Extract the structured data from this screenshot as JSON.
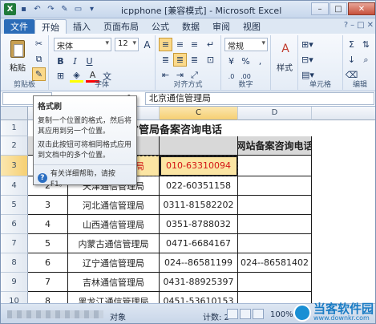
{
  "titlebar": {
    "app_icon": "X",
    "qat_icons": [
      "save-icon",
      "undo-icon",
      "redo-icon",
      "format-painter-icon",
      "open-folder-icon",
      "customize-icon"
    ],
    "title": "icpphone [兼容模式] - Microsoft Excel",
    "controls": {
      "minimize": "–",
      "maximize": "□",
      "close": "✕"
    }
  },
  "tabs": {
    "file": "文件",
    "items": [
      "开始",
      "插入",
      "页面布局",
      "公式",
      "数据",
      "审阅",
      "视图"
    ],
    "active": "开始"
  },
  "ribbon": {
    "clipboard": {
      "paste": "粘贴",
      "label": "剪贴板"
    },
    "font": {
      "name": "宋体",
      "size": "12",
      "bold": "B",
      "italic": "I",
      "underline": "U",
      "grow": "A",
      "shrink": "A",
      "fill_color": "#ffff00",
      "font_color": "#ff0000",
      "label": "字体"
    },
    "alignment": {
      "label": "对齐方式"
    },
    "number": {
      "format": "常规",
      "percent": "%",
      "comma": ",",
      "label": "数字"
    },
    "styles": {
      "label": "样式"
    },
    "cells": {
      "label": "单元格"
    },
    "editing": {
      "label": "编辑"
    }
  },
  "formula_bar": {
    "fx": "fx",
    "content": "北京通信管理局"
  },
  "tooltip": {
    "title": "格式刷",
    "p1": "复制一个位置的格式，然后将其应用到另一个位置。",
    "p2": "双击此按钮可将相同格式应用到文档中的多个位置。",
    "help": "有关详细帮助，请按 F1。",
    "help_icon": "?"
  },
  "sheet": {
    "columns": [
      "C",
      "D"
    ],
    "title": "各省管局备案咨询电话",
    "header_d": "网站备案咨询电话",
    "rows": [
      {
        "num": "1"
      },
      {
        "num": "2"
      },
      {
        "num": "3",
        "b": "北京通信管理局",
        "c": "010-63310094",
        "d": ""
      },
      {
        "num": "4",
        "a": "2",
        "b": "天津通信管理局",
        "c": "022-60351158",
        "d": ""
      },
      {
        "num": "5",
        "a": "3",
        "b": "河北通信管理局",
        "c": "0311-81582202",
        "d": ""
      },
      {
        "num": "6",
        "a": "4",
        "b": "山西通信管理局",
        "c": "0351-8788032",
        "d": ""
      },
      {
        "num": "7",
        "a": "5",
        "b": "内蒙古通信管理局",
        "c": "0471-6684167",
        "d": ""
      },
      {
        "num": "8",
        "a": "6",
        "b": "辽宁通信管理局",
        "c": "024--86581199",
        "d": "024--86581402"
      },
      {
        "num": "9",
        "a": "7",
        "b": "吉林通信管理局",
        "c": "0431-88925397",
        "d": ""
      },
      {
        "num": "10",
        "a": "8",
        "b": "黑龙江通信管理局",
        "c": "0451-53610153",
        "d": ""
      }
    ]
  },
  "status": {
    "message": "对象",
    "count": "计数: 2",
    "zoom": "100%",
    "watermark_cn": "当客软件园",
    "watermark_en": "www.downkr.com"
  }
}
